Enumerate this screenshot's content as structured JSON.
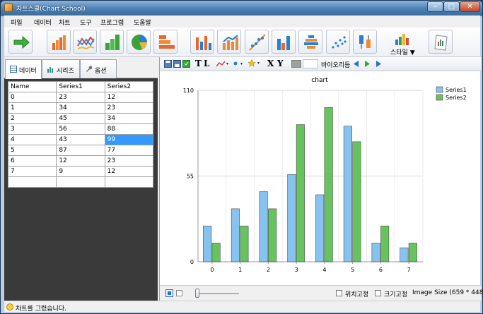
{
  "window": {
    "title": "차트스쿨(Chart School)"
  },
  "menu": [
    "파일",
    "데이터",
    "차트",
    "도구",
    "프로그램",
    "도움말"
  ],
  "toolbar": {
    "style_label": "스타일 ▼"
  },
  "tabs": [
    {
      "label": "데이터",
      "icon": "data-grid-icon"
    },
    {
      "label": "시리즈",
      "icon": "series-icon"
    },
    {
      "label": "옵션",
      "icon": "wrench-icon"
    }
  ],
  "table": {
    "headers": [
      "Name",
      "Series1",
      "Series2"
    ],
    "rows": [
      [
        "0",
        "23",
        "12"
      ],
      [
        "1",
        "34",
        "23"
      ],
      [
        "2",
        "45",
        "34"
      ],
      [
        "3",
        "56",
        "88"
      ],
      [
        "4",
        "43",
        "99"
      ],
      [
        "5",
        "87",
        "77"
      ],
      [
        "6",
        "12",
        "23"
      ],
      [
        "7",
        "9",
        "12"
      ]
    ],
    "selected_cell": "4-2"
  },
  "chart_toolbar": {
    "label": "바이오리듬",
    "text_t": "T",
    "text_l": "L",
    "text_x": "X",
    "text_y": "Y"
  },
  "chart_data": {
    "type": "bar",
    "title": "chart",
    "categories": [
      "0",
      "1",
      "2",
      "3",
      "4",
      "5",
      "6",
      "7"
    ],
    "series": [
      {
        "name": "Series1",
        "values": [
          23,
          34,
          45,
          56,
          43,
          87,
          12,
          9
        ],
        "color": "#87c3f0"
      },
      {
        "name": "Series2",
        "values": [
          12,
          23,
          34,
          88,
          99,
          77,
          23,
          12
        ],
        "color": "#66c35e"
      }
    ],
    "yticks": [
      "0",
      "55",
      "110"
    ],
    "ylim": [
      0,
      110
    ],
    "legend": "top-right",
    "grid": true
  },
  "bottom": {
    "pin_position": "위치고정",
    "pin_size": "크기고정",
    "image_size": "Image Size (659 * 448)"
  },
  "status": {
    "text": "차트를 그렸습니다."
  }
}
